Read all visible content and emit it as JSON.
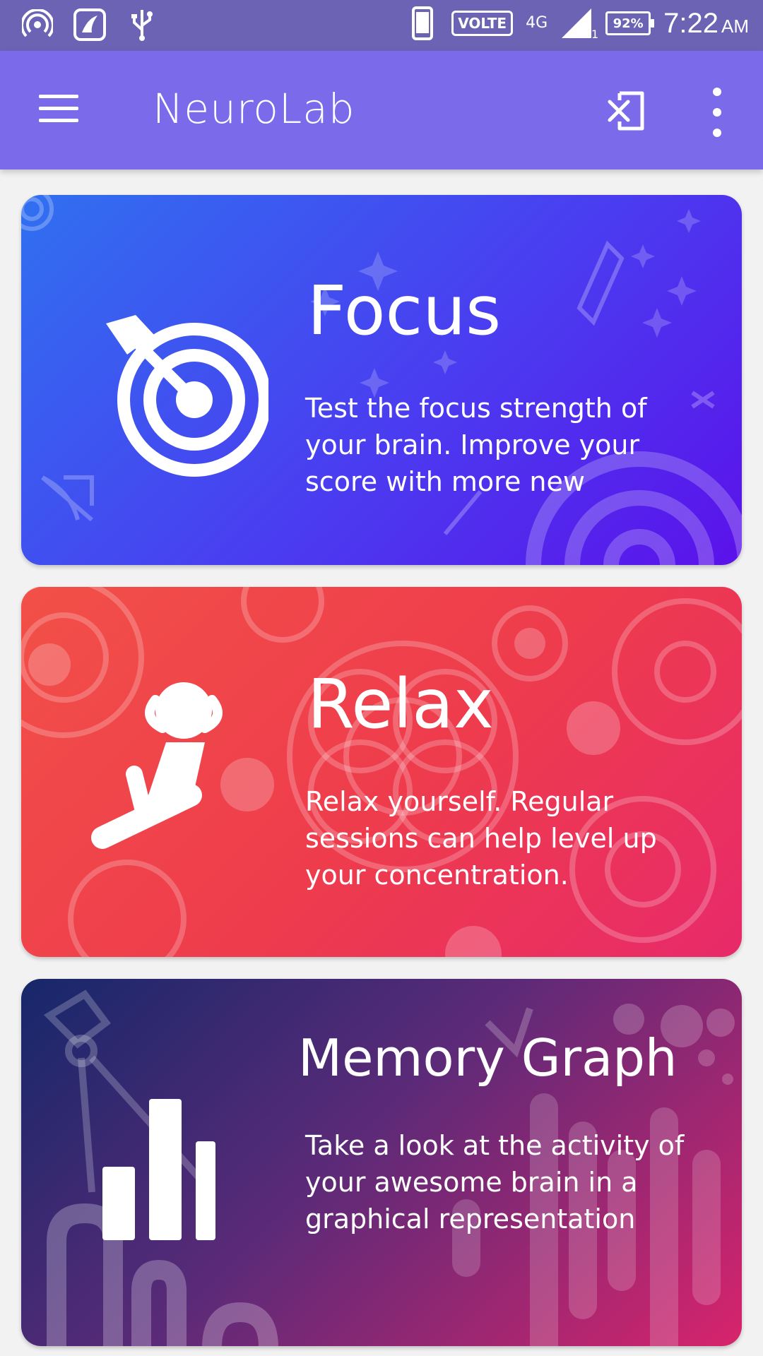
{
  "status_bar": {
    "network_label": "VOLTE",
    "network_type": "4G",
    "sim_slot": "1",
    "battery": "92%",
    "time": "7:22",
    "ampm": "AM"
  },
  "app_bar": {
    "title": "NeuroLab",
    "icons": [
      "menu-icon",
      "exit-icon",
      "more-vert-icon"
    ]
  },
  "cards": [
    {
      "title": "Focus",
      "description": "Test the focus strength of your brain. Improve your score with more new",
      "icon": "target-icon",
      "colors": [
        "#3070f0",
        "#5b12ea"
      ]
    },
    {
      "title": "Relax",
      "description": "Relax yourself. Regular sessions can help level up your concentration.",
      "icon": "relaxing-person-icon",
      "colors": [
        "#f25048",
        "#e82a6a"
      ]
    },
    {
      "title": "Memory Graph",
      "description": "Take a look at the activity of your awesome brain in a graphical representation",
      "icon": "bar-chart-icon",
      "colors": [
        "#16286a",
        "#d7246c"
      ]
    }
  ]
}
